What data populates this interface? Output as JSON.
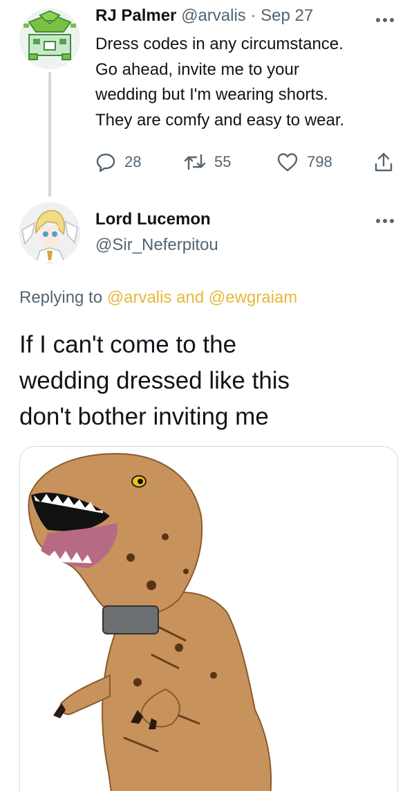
{
  "parent_tweet": {
    "display_name": "RJ Palmer",
    "handle": "@arvalis",
    "separator": "·",
    "date": "Sep 27",
    "more_icon": "more-horizontal-icon",
    "text_lines": [
      "Dress codes in any circumstance.",
      "Go ahead, invite me to your",
      "wedding but I'm wearing shorts.",
      "They are comfy and easy to wear."
    ],
    "actions": {
      "replies": "28",
      "retweets": "55",
      "likes": "798"
    },
    "avatar_colors": {
      "background": "#eef3f0",
      "plant": "#7bc043",
      "outline": "#3d8f3a"
    }
  },
  "reply_tweet": {
    "display_name": "Lord Lucemon",
    "handle": "@Sir_Neferpitou",
    "replying_prefix": "Replying to",
    "mention_1": "@arvalis",
    "conjunction": "and",
    "mention_2": "@ewgraiam",
    "text_lines": [
      "If I can't come to the",
      "wedding dressed like this",
      "don't bother inviting me"
    ],
    "media_description_icon": "inflatable-trex-costume-image"
  },
  "colors": {
    "text_primary": "#0f1419",
    "text_secondary": "#536471",
    "mention": "#e6b73b",
    "border": "#cfd9de"
  }
}
